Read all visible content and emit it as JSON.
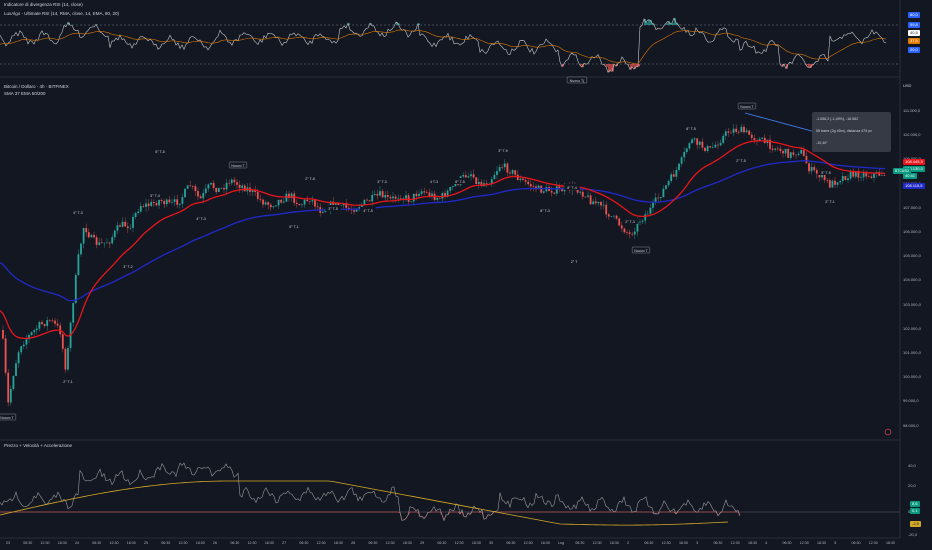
{
  "panes": {
    "top_indicator_title": "Indicatore di divergenza RSI (14, close)",
    "rsi_subtitle": "LuxAlgo - Ultimate RSI (14, RMA, close, 14, EMA, 80, 20)",
    "main_title": "Bitcoin / Dollaro · 4h · BITFINEX",
    "main_subtitle": "SMA 37 EMA 50/200",
    "bottom_title": "Prezzo + Velocità + Accelerazione"
  },
  "rsi_axis": {
    "labels": [
      "80,0",
      "59,8",
      "40,5",
      "37,5",
      "20,0"
    ],
    "colors": [
      "#2962ff",
      "#2962ff",
      "#ffffff",
      "#e07a00",
      "#2962ff"
    ]
  },
  "price_axis": {
    "currency": "USD",
    "ticks": [
      "111.000,0",
      "110.000,0",
      "109.000,0",
      "108.000,0",
      "107.000,0",
      "106.000,0",
      "105.000,0",
      "104.000,0",
      "103.000,0",
      "102.000,0",
      "101.000,0",
      "100.000,0",
      "99.000,0",
      "98.000,0"
    ],
    "tags": {
      "ema_red": "108.445,5",
      "last": "108.130,0",
      "symbol": "BTCUSD",
      "countdown": "40:41",
      "ema_blue": "108.115,5"
    }
  },
  "bottom_axis": {
    "ticks": [
      "40,0",
      "20,0",
      "0,0",
      "-20,0"
    ],
    "tags": [
      "8,6",
      "0,1",
      "-2,5"
    ]
  },
  "time_axis": [
    "23",
    "06:30",
    "12:30",
    "18:30",
    "24",
    "06:30",
    "12:30",
    "18:30",
    "25",
    "06:30",
    "12:30",
    "18:30",
    "26",
    "06:30",
    "12:30",
    "18:30",
    "27",
    "06:30",
    "12:30",
    "18:30",
    "28",
    "06:30",
    "12:30",
    "18:30",
    "29",
    "06:30",
    "12:30",
    "18:30",
    "30",
    "06:30",
    "12:30",
    "18:30",
    "Lug",
    "06:30",
    "12:30",
    "18:30",
    "2",
    "06:30",
    "12:30",
    "18:30",
    "3",
    "06:30",
    "12:30",
    "18:30",
    "4",
    "06:30",
    "12:30",
    "18:30",
    "5",
    "06:30",
    "12:30",
    "18:30"
  ],
  "tooltip": {
    "line1": "-1.658,2 (-1,49%), -16.582",
    "line2": "55 barre (2g 45m), distanza 475 px",
    "line3": "-10,40°"
  },
  "labels": {
    "nuovo_top": "Nuovo T",
    "nuovo_hh": "Nuovo T(",
    "markers": [
      "5° T-5",
      "5° T-4",
      "4° T-3",
      "3° T-2",
      "2° T-1",
      "4° T-3",
      "2° T-8",
      "5° T-1",
      "3° T-9",
      "4 T-3",
      "3° T-3",
      "4° T-5",
      "8° T-3",
      "2° T",
      "2° T-3",
      "8° T-5",
      "2° T-5",
      "5° T-5",
      "3° T-5",
      "8° T-4",
      "2° T-1",
      "6° T-5"
    ]
  },
  "colors": {
    "background": "#131722",
    "up": "#26a69a",
    "down": "#ef5350",
    "ema_red": "#e8161b",
    "ema_blue": "#2029c9",
    "trendline": "#3f7ff0",
    "yellow": "#d4a926"
  }
}
